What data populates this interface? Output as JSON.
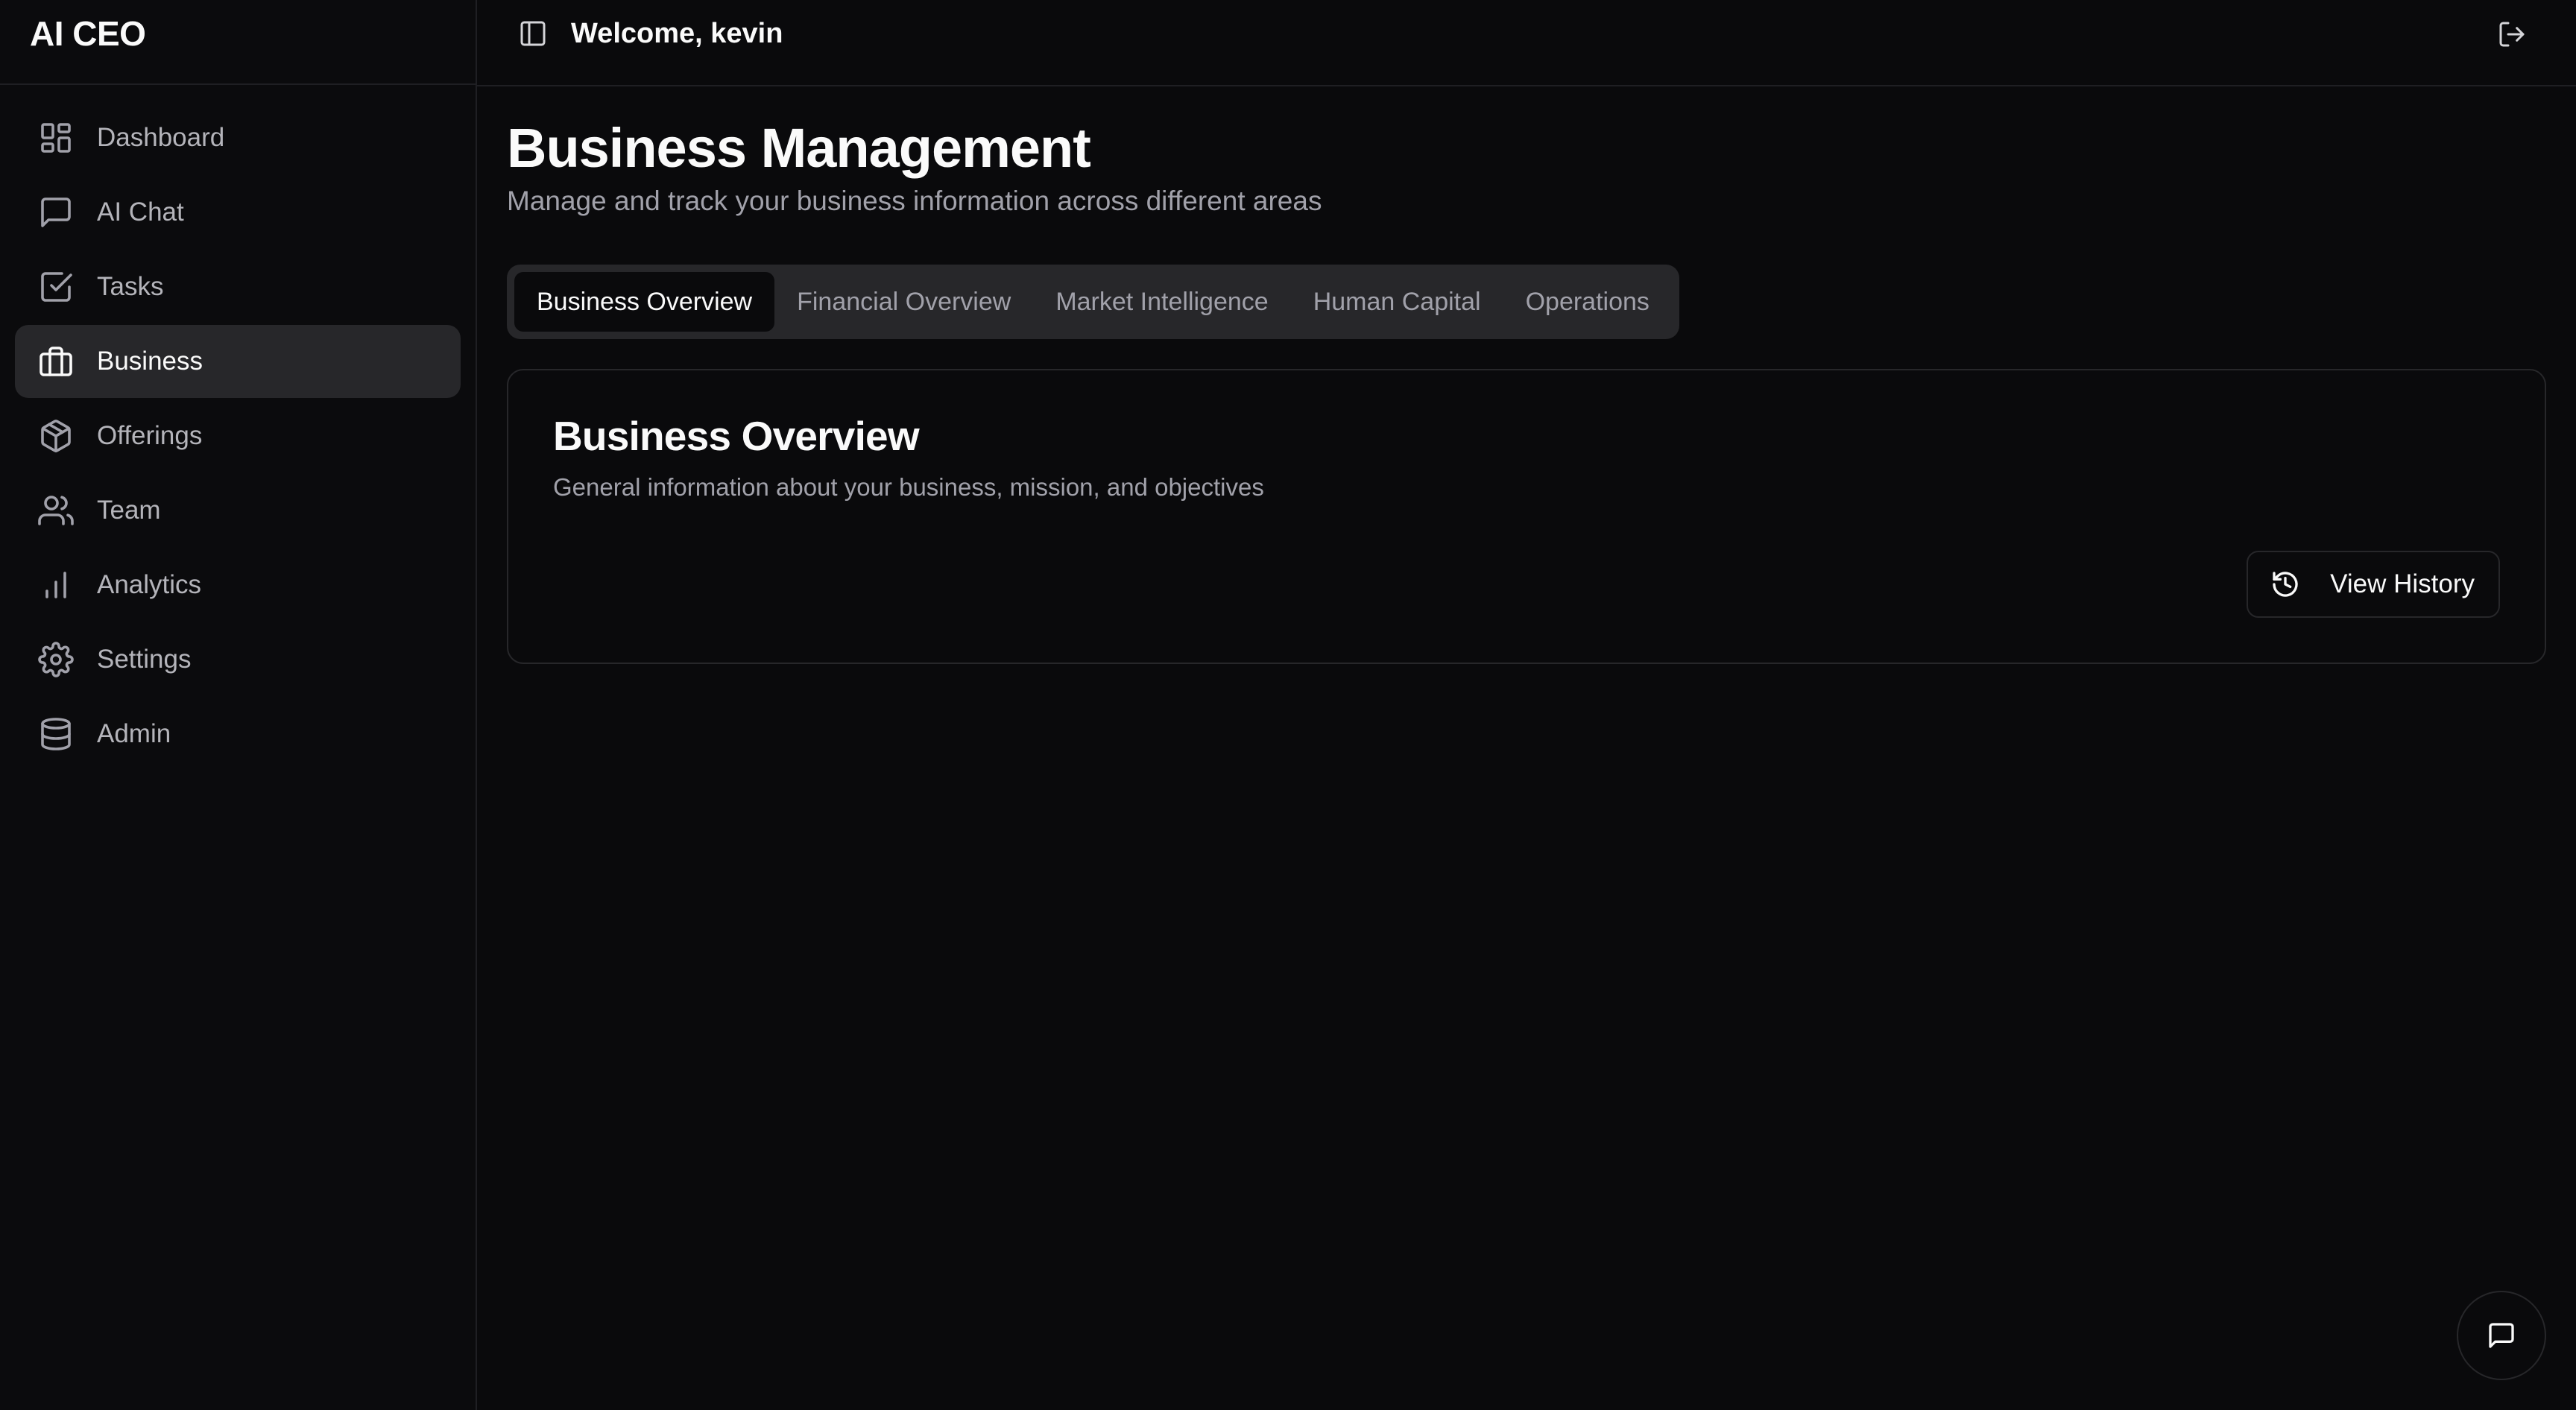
{
  "app": {
    "brand": "AI CEO"
  },
  "header": {
    "welcome": "Welcome, kevin"
  },
  "sidebar": {
    "items": [
      {
        "label": "Dashboard",
        "icon": "dashboard-icon",
        "active": false
      },
      {
        "label": "AI Chat",
        "icon": "message-square-icon",
        "active": false
      },
      {
        "label": "Tasks",
        "icon": "check-square-icon",
        "active": false
      },
      {
        "label": "Business",
        "icon": "briefcase-icon",
        "active": true
      },
      {
        "label": "Offerings",
        "icon": "package-icon",
        "active": false
      },
      {
        "label": "Team",
        "icon": "users-icon",
        "active": false
      },
      {
        "label": "Analytics",
        "icon": "bar-chart-icon",
        "active": false
      },
      {
        "label": "Settings",
        "icon": "gear-icon",
        "active": false
      },
      {
        "label": "Admin",
        "icon": "database-icon",
        "active": false
      }
    ]
  },
  "page": {
    "title": "Business Management",
    "subtitle": "Manage and track your business information across different areas"
  },
  "tabs": [
    {
      "label": "Business Overview",
      "active": true
    },
    {
      "label": "Financial Overview",
      "active": false
    },
    {
      "label": "Market Intelligence",
      "active": false
    },
    {
      "label": "Human Capital",
      "active": false
    },
    {
      "label": "Operations",
      "active": false
    }
  ],
  "card": {
    "title": "Business Overview",
    "description": "General information about your business, mission, and objectives",
    "history_button": "View History"
  },
  "colors": {
    "background": "#0a0a0c",
    "border": "#27272a",
    "active_bg": "#27272a",
    "text": "#fafafa",
    "muted": "#a1a1aa"
  }
}
